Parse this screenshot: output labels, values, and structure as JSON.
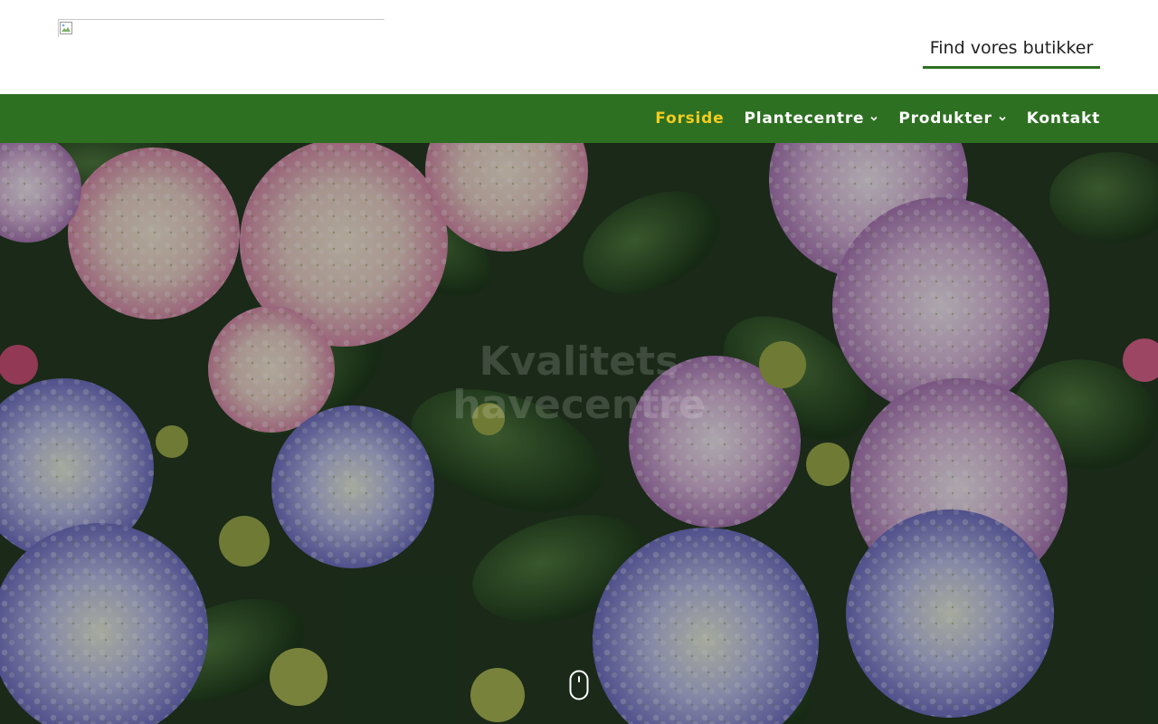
{
  "header": {
    "find_stores_label": "Find vores butikker",
    "logo_icon": "broken-image-icon"
  },
  "nav": {
    "items": [
      {
        "label": "Forside",
        "active": true,
        "has_dropdown": false
      },
      {
        "label": "Plantecentre",
        "active": false,
        "has_dropdown": true
      },
      {
        "label": "Produkter",
        "active": false,
        "has_dropdown": true
      },
      {
        "label": "Kontakt",
        "active": false,
        "has_dropdown": false
      }
    ]
  },
  "hero": {
    "title": "Kvalitets havecentre",
    "subtitle": "",
    "scroll_icon": "mouse-scroll-icon"
  },
  "colors": {
    "brand_green": "#2e7022",
    "active_nav": "#f2cc1f",
    "nav_text": "#ffffff"
  }
}
